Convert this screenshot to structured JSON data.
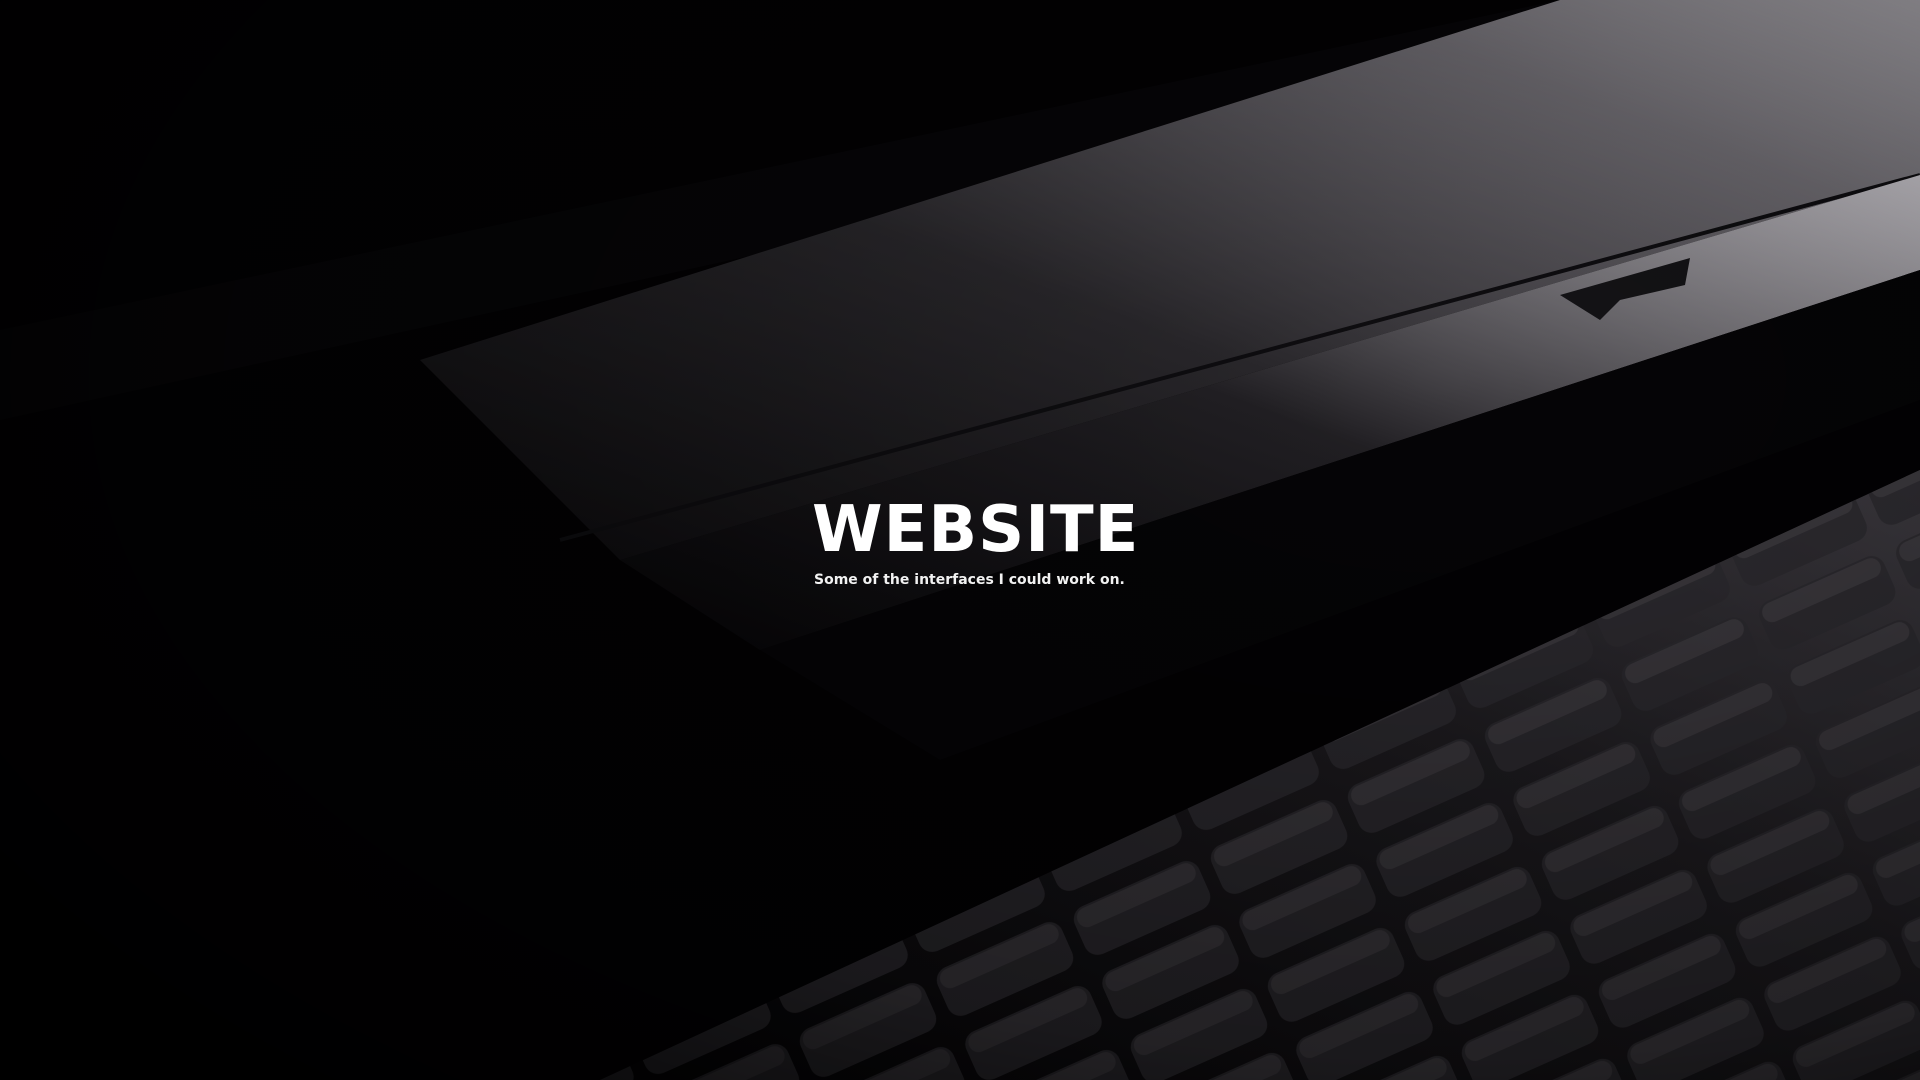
{
  "hero": {
    "title": "WEBSITE",
    "subtitle": "Some of the interfaces I could work on.",
    "background": "laptop-photo",
    "colors": {
      "background": "#020103",
      "text": "#ffffff"
    }
  }
}
